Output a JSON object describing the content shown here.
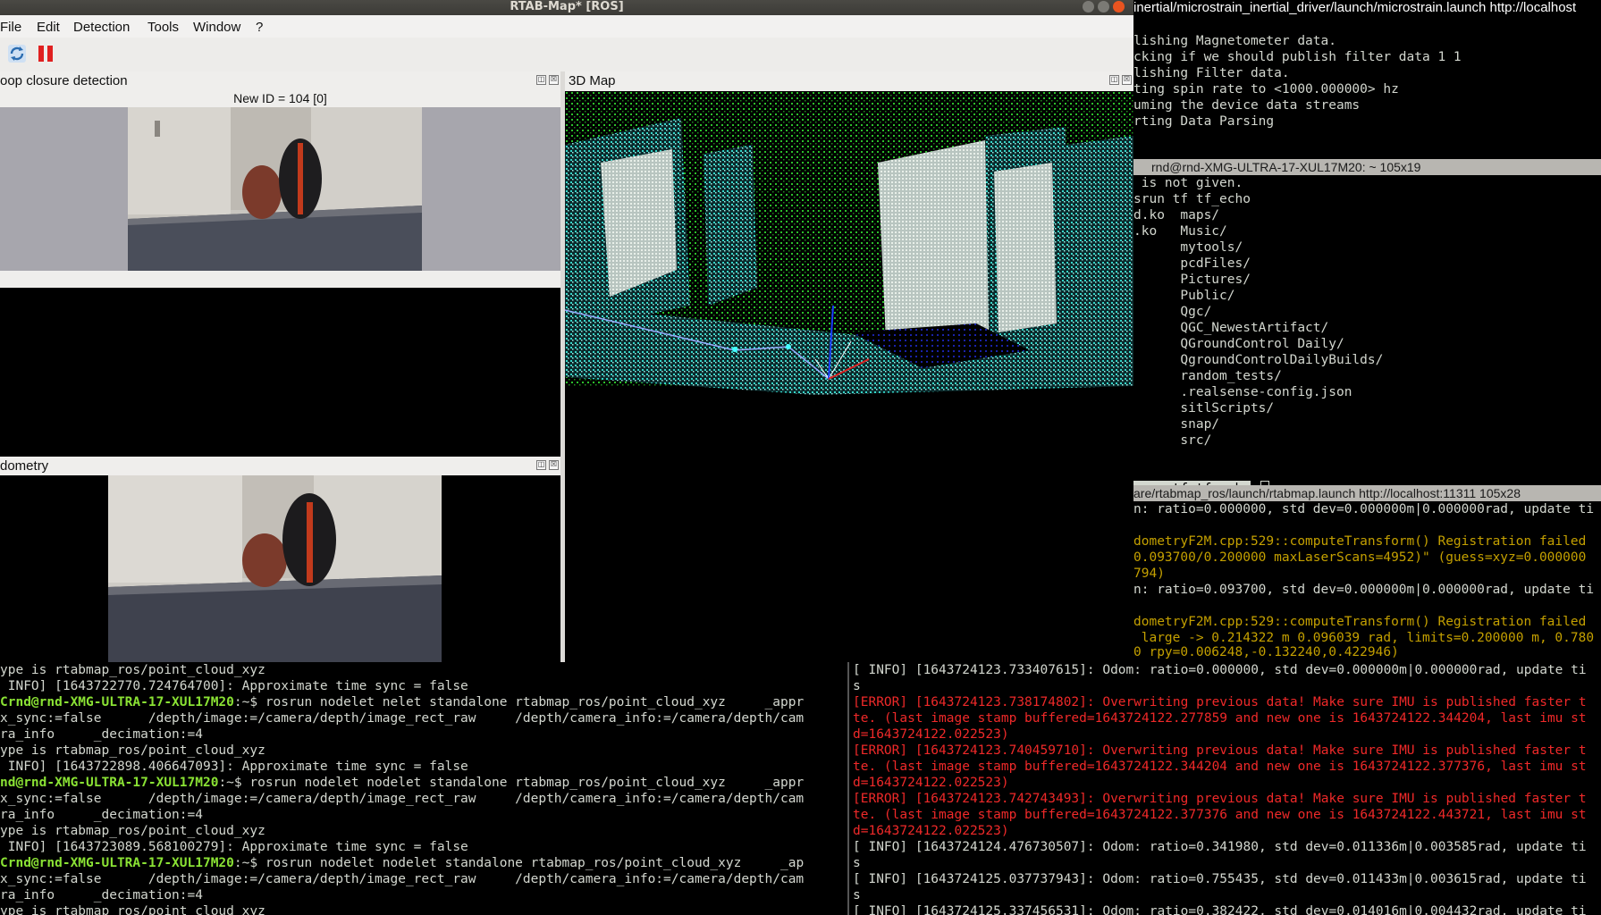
{
  "rtab": {
    "title": "RTAB-Map* [ROS]",
    "menus": [
      "File",
      "Edit",
      "Detection",
      "Tools",
      "Window",
      "?"
    ],
    "toolbar": {
      "refresh_icon": "refresh-icon",
      "pause_icon": "pause-icon"
    },
    "loop_panel": {
      "title": "oop closure detection",
      "new_id": "New ID = 104 [0]"
    },
    "odometry_panel": {
      "title": "dometry"
    },
    "map_panel": {
      "title": "3D Map"
    },
    "dock_button_float": "◫",
    "dock_button_close": "☒"
  },
  "term_top": {
    "title": "inertial/microstrain_inertial_driver/launch/microstrain.launch http://localhost",
    "lines": [
      "lishing Magnetometer data.",
      "cking if we should publish filter data 1 1",
      "lishing Filter data.",
      "ting spin rate to <1000.000000> hz",
      "uming the device data streams",
      "rting Data Parsing"
    ]
  },
  "term_mid": {
    "title": "rnd@rnd-XMG-ULTRA-17-XUL17M20: ~ 105x19",
    "lines": [
      " is not given.",
      "srun tf tf_echo",
      "d.ko  maps/",
      ".ko   Music/",
      "      mytools/",
      "      pcdFiles/",
      "      Pictures/",
      "      Public/",
      "      Qgc/",
      "      QGC_NewestArtifact/",
      "      QGroundControl Daily/",
      "      QgroundControlDailyBuilds/",
      "      random_tests/",
      "      .realsense-config.json",
      "      sitlScripts/",
      "      snap/",
      "      src/"
    ],
    "prompt": "srun tf tf_echo"
  },
  "term_right": {
    "title": "are/rtabmap_ros/launch/rtabmap.launch http://localhost:11311 105x28",
    "lines": [
      {
        "t": "n: ratio=0.000000, std dev=0.000000m|0.000000rad, update ti",
        "c": "white"
      },
      {
        "t": "",
        "c": "white"
      },
      {
        "t": "dometryF2M.cpp:529::computeTransform() Registration failed",
        "c": "yellow"
      },
      {
        "t": "0.093700/0.200000 maxLaserScans=4952)\" (guess=xyz=0.000000",
        "c": "yellow"
      },
      {
        "t": "794)",
        "c": "yellow"
      },
      {
        "t": "n: ratio=0.093700, std dev=0.000000m|0.000000rad, update ti",
        "c": "white"
      },
      {
        "t": "",
        "c": "white"
      },
      {
        "t": "dometryF2M.cpp:529::computeTransform() Registration failed",
        "c": "yellow"
      },
      {
        "t": " large -> 0.214322 m 0.096039 rad, limits=0.200000 m, 0.780",
        "c": "yellow"
      },
      {
        "t": "0 rpy=0.006248,-0.132240,0.422946)",
        "c": "yellow"
      },
      {
        "t": "[ INFO] [1643724123.733407615]: Odom: ratio=0.000000, std dev=0.000000m|0.000000rad, update ti",
        "c": "white"
      },
      {
        "t": "s",
        "c": "white"
      },
      {
        "t": "[ERROR] [1643724123.738174802]: Overwriting previous data! Make sure IMU is published faster t",
        "c": "red"
      },
      {
        "t": "te. (last image stamp buffered=1643724122.277859 and new one is 1643724122.344204, last imu st",
        "c": "red"
      },
      {
        "t": "d=1643724122.022523)",
        "c": "red"
      },
      {
        "t": "[ERROR] [1643724123.740459710]: Overwriting previous data! Make sure IMU is published faster t",
        "c": "red"
      },
      {
        "t": "te. (last image stamp buffered=1643724122.344204 and new one is 1643724122.377376, last imu st",
        "c": "red"
      },
      {
        "t": "d=1643724122.022523)",
        "c": "red"
      },
      {
        "t": "[ERROR] [1643724123.742743493]: Overwriting previous data! Make sure IMU is published faster t",
        "c": "red"
      },
      {
        "t": "te. (last image stamp buffered=1643724122.377376 and new one is 1643724122.443721, last imu st",
        "c": "red"
      },
      {
        "t": "d=1643724122.022523)",
        "c": "red"
      },
      {
        "t": "[ INFO] [1643724124.476730507]: Odom: ratio=0.341980, std dev=0.011336m|0.003585rad, update ti",
        "c": "white"
      },
      {
        "t": "s",
        "c": "white"
      },
      {
        "t": "[ INFO] [1643724125.037737943]: Odom: ratio=0.755435, std dev=0.011433m|0.003615rad, update ti",
        "c": "white"
      },
      {
        "t": "s",
        "c": "white"
      },
      {
        "t": "[ INFO] [1643724125.337456531]: Odom: ratio=0.382422, std dev=0.014016m|0.004432rad, update ti",
        "c": "white"
      }
    ]
  },
  "term_left": {
    "lines": [
      {
        "p": "",
        "t": "ype is rtabmap_ros/point_cloud_xyz"
      },
      {
        "p": "",
        "t": " INFO] [1643722770.724764700]: Approximate time sync = false"
      },
      {
        "p": "Crnd@rnd-XMG-ULTRA-17-XUL17M20",
        "t": ":~$ rosrun nodelet nelet standalone rtabmap_ros/point_cloud_xyz     _appr"
      },
      {
        "p": "",
        "t": "x_sync:=false      /depth/image:=/camera/depth/image_rect_raw     /depth/camera_info:=/camera/depth/cam"
      },
      {
        "p": "",
        "t": "ra_info     _decimation:=4"
      },
      {
        "p": "",
        "t": "ype is rtabmap_ros/point_cloud_xyz"
      },
      {
        "p": "",
        "t": " INFO] [1643722898.406647093]: Approximate time sync = false"
      },
      {
        "p": "nd@rnd-XMG-ULTRA-17-XUL17M20",
        "t": ":~$ rosrun nodelet nodelet standalone rtabmap_ros/point_cloud_xyz     _appr"
      },
      {
        "p": "",
        "t": "x_sync:=false      /depth/image:=/camera/depth/image_rect_raw     /depth/camera_info:=/camera/depth/cam"
      },
      {
        "p": "",
        "t": "ra_info     _decimation:=4"
      },
      {
        "p": "",
        "t": "ype is rtabmap_ros/point_cloud_xyz"
      },
      {
        "p": "",
        "t": " INFO] [1643723089.568100279]: Approximate time sync = false"
      },
      {
        "p": "Crnd@rnd-XMG-ULTRA-17-XUL17M20",
        "t": ":~$ rosrun nodelet nodelet standalone rtabmap_ros/point_cloud_xyz     _ap"
      },
      {
        "p": "",
        "t": "x_sync:=false      /depth/image:=/camera/depth/image_rect_raw     /depth/camera_info:=/camera/depth/cam"
      },
      {
        "p": "",
        "t": "ra_info     _decimation:=4"
      },
      {
        "p": "",
        "t": "ype is rtabmap_ros/point_cloud_xyz"
      }
    ]
  },
  "colors": {
    "prompt_green": "#8ae234",
    "error_red": "#ef2929",
    "warn_yellow": "#c4a000",
    "term_text": "#d3d7cf"
  }
}
